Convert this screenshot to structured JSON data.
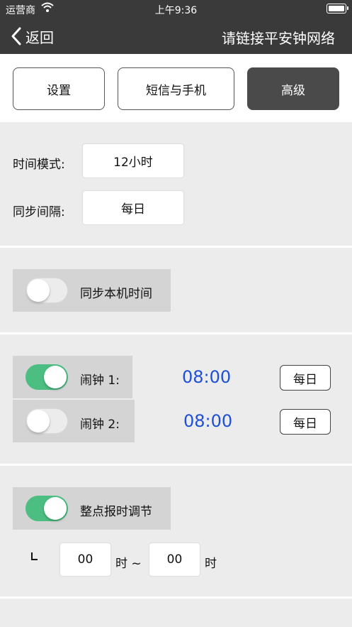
{
  "status_bar": {
    "carrier": "运营商",
    "time": "上午9:36",
    "wifi_icon": "wifi-icon",
    "battery_icon": "battery-icon"
  },
  "nav": {
    "back_label": "返回",
    "title": "请链接平安钟网络"
  },
  "tabs": [
    {
      "label": "设置",
      "active": false
    },
    {
      "label": "短信与手机",
      "active": false
    },
    {
      "label": "高级",
      "active": true
    }
  ],
  "time_settings": {
    "mode_label": "时间模式:",
    "mode_value": "12小时",
    "sync_label": "同步间隔:",
    "sync_value": "每日"
  },
  "sync_local": {
    "label": "同步本机时间",
    "enabled": false
  },
  "alarms": [
    {
      "label": "闹钟 1:",
      "time": "08:00",
      "repeat": "每日",
      "enabled": true
    },
    {
      "label": "闹钟 2:",
      "time": "08:00",
      "repeat": "每日",
      "enabled": false
    }
  ],
  "hourly_chime": {
    "label": "整点报时调节",
    "enabled": true,
    "start_hour": "00",
    "start_unit": "时 ~",
    "end_hour": "00",
    "end_unit": "时"
  },
  "colors": {
    "bar_bg": "#3a3a3a",
    "switch_on": "#4cbe82",
    "time_blue": "#1f4fd6"
  }
}
